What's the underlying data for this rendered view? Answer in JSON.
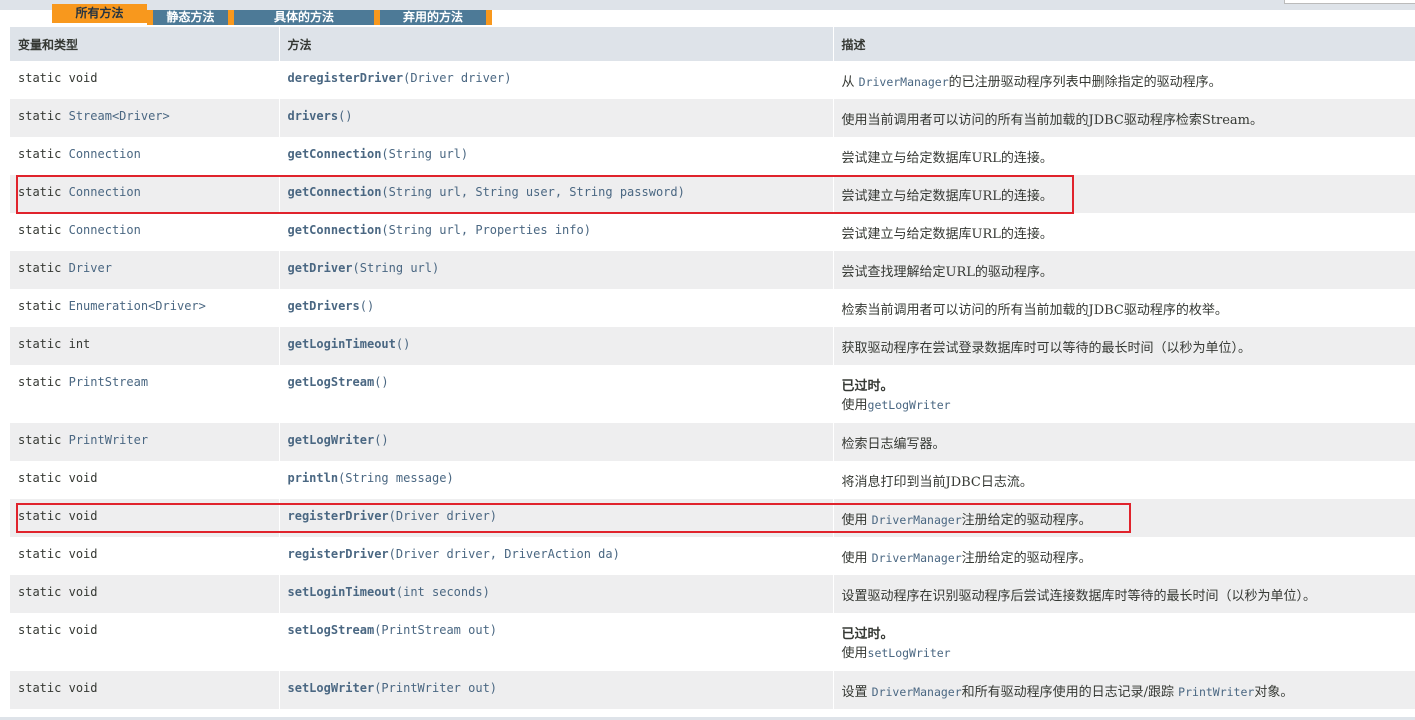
{
  "tabs": [
    {
      "label": "所有方法",
      "active": true
    },
    {
      "label": "静态方法",
      "active": false
    },
    {
      "label": "具体的方法",
      "active": false
    },
    {
      "label": "弃用的方法",
      "active": false
    }
  ],
  "headers": {
    "type": "变量和类型",
    "method": "方法",
    "desc": "描述"
  },
  "rows": [
    {
      "mod": "static",
      "type": "void",
      "method": "deregisterDriver",
      "params": "(Driver driver)",
      "desc_pre": "从 ",
      "desc_code": "DriverManager",
      "desc_post": "的已注册驱动程序列表中删除指定的驱动程序。"
    },
    {
      "mod": "static",
      "type": "Stream<Driver>",
      "method": "drivers",
      "params": "()",
      "desc": "使用当前调用者可以访问的所有当前加载的JDBC驱动程序检索Stream。"
    },
    {
      "mod": "static",
      "type": "Connection",
      "method": "getConnection",
      "params": "(String url)",
      "desc": "尝试建立与给定数据库URL的连接。"
    },
    {
      "mod": "static",
      "type": "Connection",
      "method": "getConnection",
      "params": "(String url, String user, String password)",
      "desc": "尝试建立与给定数据库URL的连接。",
      "highlighted": true
    },
    {
      "mod": "static",
      "type": "Connection",
      "method": "getConnection",
      "params": "(String url, Properties info)",
      "desc": "尝试建立与给定数据库URL的连接。"
    },
    {
      "mod": "static",
      "type": "Driver",
      "method": "getDriver",
      "params": "(String url)",
      "desc": "尝试查找理解给定URL的驱动程序。"
    },
    {
      "mod": "static",
      "type": "Enumeration<Driver>",
      "method": "getDrivers",
      "params": "()",
      "desc": "检索当前调用者可以访问的所有当前加载的JDBC驱动程序的枚举。"
    },
    {
      "mod": "static",
      "type": "int",
      "method": "getLoginTimeout",
      "params": "()",
      "desc": "获取驱动程序在尝试登录数据库时可以等待的最长时间（以秒为单位）。"
    },
    {
      "mod": "static",
      "type": "PrintStream",
      "method": "getLogStream",
      "params": "()",
      "deprecated": "已过时。",
      "dep_pre": "使用",
      "dep_code": "getLogWriter"
    },
    {
      "mod": "static",
      "type": "PrintWriter",
      "method": "getLogWriter",
      "params": "()",
      "desc": "检索日志编写器。"
    },
    {
      "mod": "static",
      "type": "void",
      "method": "println",
      "params": "(String message)",
      "desc": "将消息打印到当前JDBC日志流。"
    },
    {
      "mod": "static",
      "type": "void",
      "method": "registerDriver",
      "params": "(Driver driver)",
      "desc_pre": "使用 ",
      "desc_code": "DriverManager",
      "desc_post": "注册给定的驱动程序。",
      "highlighted": true
    },
    {
      "mod": "static",
      "type": "void",
      "method": "registerDriver",
      "params": "(Driver driver, DriverAction da)",
      "desc_pre": "使用 ",
      "desc_code": "DriverManager",
      "desc_post": "注册给定的驱动程序。"
    },
    {
      "mod": "static",
      "type": "void",
      "method": "setLoginTimeout",
      "params": "(int seconds)",
      "desc": "设置驱动程序在识别驱动程序后尝试连接数据库时等待的最长时间（以秒为单位）。"
    },
    {
      "mod": "static",
      "type": "void",
      "method": "setLogStream",
      "params": "(PrintStream out)",
      "deprecated": "已过时。",
      "dep_pre": "使用",
      "dep_code": "setLogWriter"
    },
    {
      "mod": "static",
      "type": "void",
      "method": "setLogWriter",
      "params": "(PrintWriter out)",
      "desc_pre": "设置 ",
      "desc_code": "DriverManager",
      "desc_post": "和所有驱动程序使用的日志记录/跟踪 ",
      "desc_code2": "PrintWriter",
      "desc_post2": "对象。"
    }
  ],
  "colors": {
    "header_bg": "#dee3e9",
    "alt_row": "#eeeeef",
    "link": "#4a6782",
    "tab_active": "#f8981d",
    "tab": "#4d7a97",
    "highlight_box": "#e0232c"
  }
}
